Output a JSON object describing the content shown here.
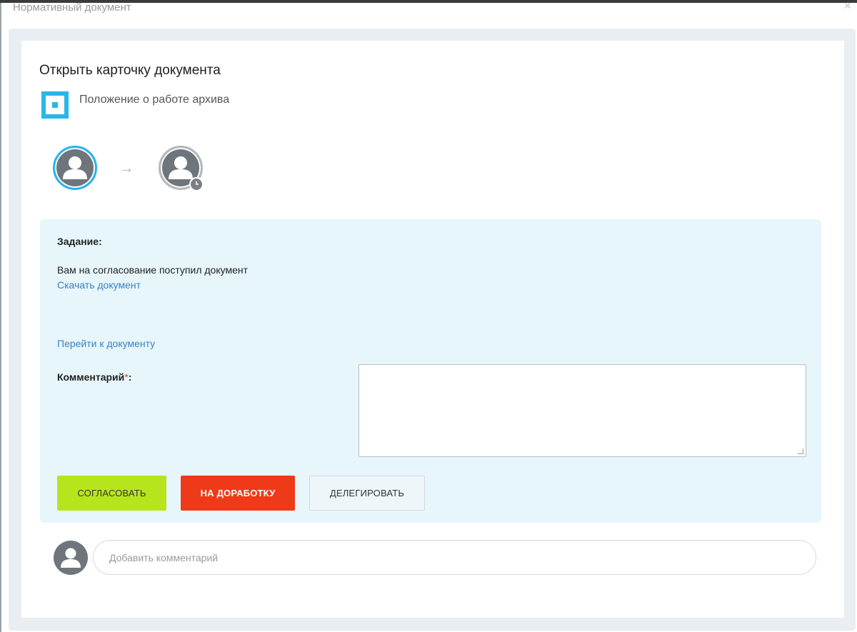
{
  "window": {
    "title": "Нормативный документ",
    "close_glyph": "×"
  },
  "card": {
    "title": "Открыть карточку документа",
    "document_name": "Положение о работе архива",
    "document_icon": "document-square-icon",
    "flow_arrow": "→"
  },
  "task": {
    "label": "Задание:",
    "text": "Вам на согласование поступил документ",
    "download_link": "Скачать документ",
    "goto_link": "Перейти к документу",
    "comment_label": "Комментарий",
    "comment_required_mark": "*",
    "comment_label_suffix": ":",
    "comment_value": ""
  },
  "buttons": {
    "approve": "СОГЛАСОВАТЬ",
    "rework": "НА ДОРАБОТКУ",
    "delegate": "ДЕЛЕГИРОВАТЬ"
  },
  "comments": {
    "placeholder": "Добавить комментарий"
  },
  "colors": {
    "accent": "#29b6e8",
    "panel_bg": "#e6f6fb",
    "approve": "#b7e51d",
    "rework": "#ef3a1a",
    "link": "#3b7fc4"
  }
}
